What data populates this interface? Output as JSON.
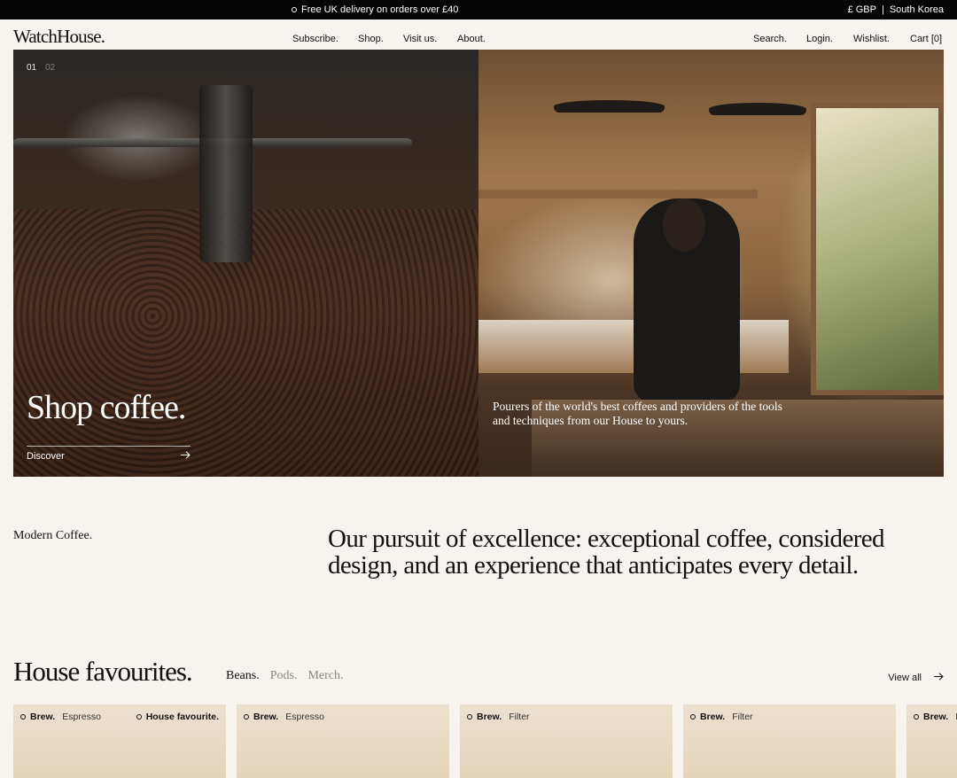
{
  "topbar": {
    "promo": "Free UK delivery on orders over £40",
    "currency": "£ GBP",
    "separator": "|",
    "country": "South Korea"
  },
  "nav": {
    "logo": "WatchHouse.",
    "links": [
      "Subscribe.",
      "Shop.",
      "Visit us.",
      "About."
    ],
    "right_links": [
      "Search.",
      "Login.",
      "Wishlist.",
      "Cart [0]"
    ]
  },
  "hero": {
    "pager": [
      "01",
      "02"
    ],
    "title": "Shop coffee.",
    "cta": "Discover",
    "cta_icon": "arrow-right-icon",
    "caption": "Pourers of the world's best coffees and providers of the tools and techniques from our House to yours."
  },
  "intro": {
    "label": "Modern Coffee.",
    "text": "Our pursuit of excellence: exceptional coffee, considered design, and an experience that anticipates every detail."
  },
  "favourites": {
    "title": "House favourites.",
    "tabs": [
      "Beans.",
      "Pods.",
      "Merch."
    ],
    "active_tab": "Beans.",
    "view_all": "View all",
    "cards": [
      {
        "tag": "Brew.",
        "category": "Espresso",
        "badge": "House favourite."
      },
      {
        "tag": "Brew.",
        "category": "Espresso"
      },
      {
        "tag": "Brew.",
        "category": "Filter"
      },
      {
        "tag": "Brew.",
        "category": "Filter"
      },
      {
        "tag": "Brew.",
        "category": "F"
      }
    ]
  },
  "colors": {
    "background": "#f7f3ee",
    "topbar": "#050505",
    "card": "#e8dcc5"
  }
}
